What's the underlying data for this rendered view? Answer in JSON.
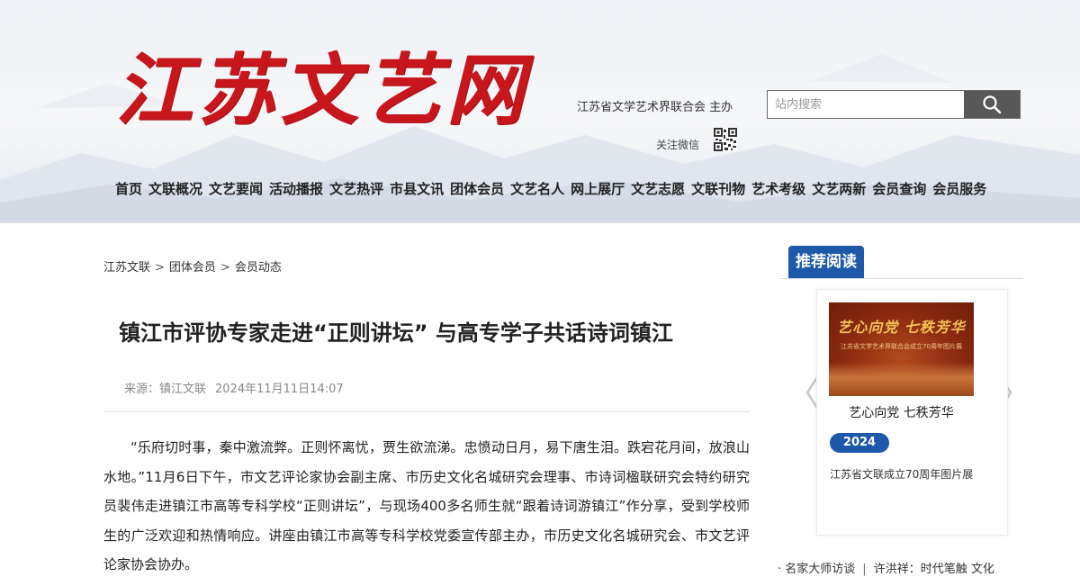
{
  "header": {
    "logo_text": "江苏文艺网",
    "host": "江苏省文学艺术界联合会 主办",
    "search_placeholder": "站内搜索",
    "follow_label": "关注微信",
    "search_icon": "search-icon",
    "qr_icon": "qr-code-icon"
  },
  "nav": {
    "items": [
      "首页",
      "文联概况",
      "文艺要闻",
      "活动播报",
      "文艺热评",
      "市县文讯",
      "团体会员",
      "文艺名人",
      "网上展厅",
      "文艺志愿",
      "文联刊物",
      "艺术考级",
      "文艺两新",
      "会员查询",
      "会员服务"
    ]
  },
  "breadcrumb": {
    "items": [
      "江苏文联",
      "团体会员",
      "会员动态"
    ],
    "separator": ">"
  },
  "article": {
    "title": "镇江市评协专家走进“正则讲坛” 与高专学子共话诗词镇江",
    "source": "来源：镇江文联",
    "date": "2024年11月11日14:07",
    "body": "“乐府切时事，秦中激流弊。正则怀离忧，贾生欲流涕。忠愤动日月，易下唐生泪。跌宕花月间，放浪山水地。”11月6日下午，市文艺评论家协会副主席、市历史文化名城研究会理事、市诗词楹联研究会特约研究员裴伟走进镇江市高等专科学校“正则讲坛”，与现场400多名师生就“跟着诗词游镇江”作分享，受到学校师生的广泛欢迎和热情响应。讲座由镇江市高等专科学校党委宣传部主办，市历史文化名城研究会、市文艺评论家协会协办。"
  },
  "sidebar": {
    "tab_label": "推荐阅读",
    "banner_title": "艺心向党 七秩芳华",
    "banner_sub": "江苏省文学艺术界联合会成立70周年图片展",
    "caption": "艺心向党  七秩芳华",
    "year": "2024",
    "desc": "江苏省文联成立70周年图片展",
    "prev_arrow": "〈",
    "next_arrow": "〉",
    "ticker": {
      "bullet": "·",
      "item1": "名家大师访谈",
      "pipe": "|",
      "item2": "许洪祥：时代笔触 文化"
    }
  },
  "colors": {
    "brand_red": "#c8161d",
    "accent_blue": "#1d59a8",
    "search_button": "#585858"
  }
}
